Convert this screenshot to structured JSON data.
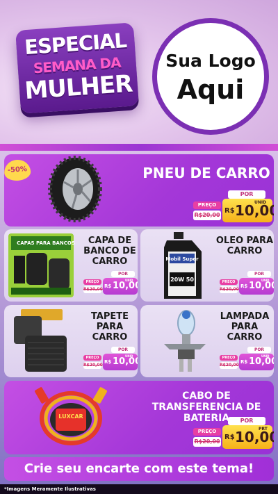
{
  "header": {
    "badge_line1": "ESPECIAL",
    "badge_line2": "SEMANA DA",
    "badge_line3": "MULHER",
    "logo_line1": "Sua Logo",
    "logo_line2": "Aqui"
  },
  "discount_badge": "-50%",
  "products": [
    {
      "title": "PNEU DE CARRO",
      "label_por": "POR",
      "label_preco": "PREÇO",
      "old_price": "R$20,00",
      "price_prefix": "R$",
      "price": "10,00",
      "unit": "UNID"
    },
    {
      "title": "CAPA DE BANCO DE CARRO",
      "label_por": "POR",
      "label_preco": "PREÇO",
      "old_price": "R$20,00",
      "price_prefix": "R$",
      "price": "10,00",
      "unit": "UNID"
    },
    {
      "title": "OLEO PARA CARRO",
      "label_por": "POR",
      "label_preco": "PREÇO",
      "old_price": "R$20,00",
      "price_prefix": "R$",
      "price": "10,00",
      "unit": "UNID"
    },
    {
      "title": "TAPETE PARA CARRO",
      "label_por": "POR",
      "label_preco": "PREÇO",
      "old_price": "R$20,00",
      "price_prefix": "R$",
      "price": "10,00",
      "unit": "UNID"
    },
    {
      "title": "LAMPADA PARA CARRO",
      "label_por": "POR",
      "label_preco": "PREÇO",
      "old_price": "R$20,00",
      "price_prefix": "R$",
      "price": "10,00",
      "unit": "UNID"
    },
    {
      "title": "CABO DE TRANSFERENCIA DE BATERIA",
      "label_por": "POR",
      "label_preco": "PREÇO",
      "old_price": "R$20,00",
      "price_prefix": "R$",
      "price": "10,00",
      "unit": "PRT"
    }
  ],
  "product_images": {
    "seat_cover_pack_text": "CAPAS PARA BANCOS",
    "oil_brand": "Mobil Super",
    "oil_grade": "20W 50",
    "cable_brand": "LUXCAR"
  },
  "cta": "Crie seu encarte com este tema!",
  "disclaimer": "*Imagens Meramente Ilustrativas"
}
